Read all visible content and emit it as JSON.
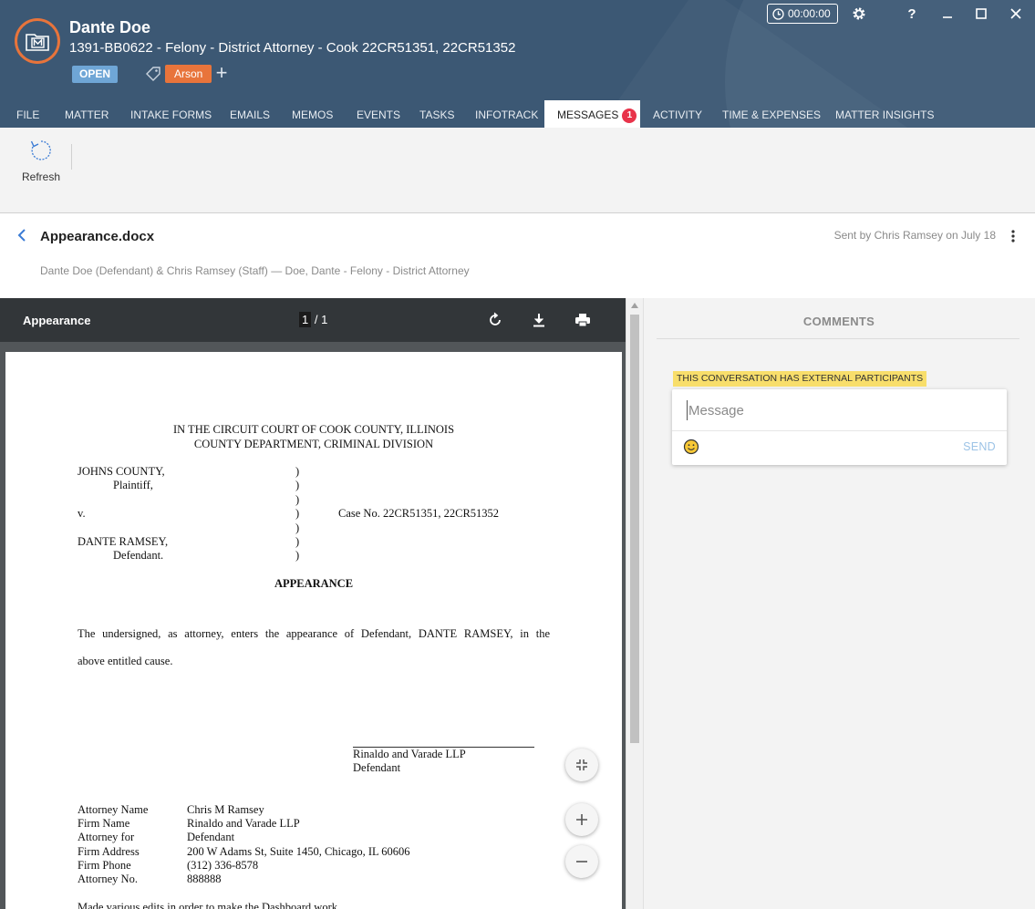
{
  "header": {
    "client_name": "Dante Doe",
    "matter": "1391-BB0622 - Felony - District Attorney - Cook 22CR51351, 22CR51352",
    "status": "OPEN",
    "tag": "Arson",
    "add_tag": "+",
    "timer": "00:00:00",
    "status_color": "#6fa6d6",
    "tag_color": "#e8743b",
    "brand_color": "#3c5874"
  },
  "window_controls": {
    "help": "?",
    "icons": [
      "gear-icon",
      "question-icon",
      "minimize-icon",
      "maximize-icon",
      "close-icon"
    ]
  },
  "tabs": [
    {
      "label": "FILE"
    },
    {
      "label": "MATTER"
    },
    {
      "label": "INTAKE FORMS"
    },
    {
      "label": "EMAILS"
    },
    {
      "label": "MEMOS"
    },
    {
      "label": "EVENTS"
    },
    {
      "label": "TASKS"
    },
    {
      "label": "INFOTRACK"
    },
    {
      "label": "MESSAGES",
      "count": "1",
      "active": true
    },
    {
      "label": "ACTIVITY"
    },
    {
      "label": "TIME & EXPENSES"
    },
    {
      "label": "MATTER INSIGHTS"
    }
  ],
  "toolbar": {
    "refresh_label": "Refresh"
  },
  "message": {
    "title": "Appearance.docx",
    "sent_by": "Sent by Chris Ramsey on July 18",
    "participants": "Dante Doe (Defendant) & Chris Ramsey (Staff) — Doe, Dante - Felony - District Attorney"
  },
  "viewer": {
    "doc_name": "Appearance",
    "page_current": "1",
    "page_total": "/ 1",
    "icons": [
      "rotate-icon",
      "download-icon",
      "print-icon",
      "fit-page-icon",
      "zoom-in-icon",
      "zoom-out-icon"
    ]
  },
  "document": {
    "court_line1": "IN THE CIRCUIT COURT OF COOK COUNTY, ILLINOIS",
    "court_line2": "COUNTY DEPARTMENT, CRIMINAL DIVISION",
    "plaintiff_name": "JOHNS COUNTY,",
    "plaintiff_role": "Plaintiff,",
    "versus": "v.",
    "case_no": "Case No. 22CR51351, 22CR51352",
    "defendant_name": "DANTE RAMSEY,",
    "defendant_role": "Defendant.",
    "paren": ")",
    "heading": "APPEARANCE",
    "body_line1": "The undersigned, as attorney, enters the appearance of Defendant, DANTE RAMSEY, in the",
    "body_line2": "above entitled cause.",
    "sig_firm": "Rinaldo and Varade LLP",
    "sig_role": "Defendant",
    "info": [
      {
        "label": "Attorney Name",
        "value": "Chris M Ramsey"
      },
      {
        "label": "Firm Name",
        "value": "Rinaldo and Varade LLP"
      },
      {
        "label": "Attorney for",
        "value": "Defendant"
      },
      {
        "label": "Firm Address",
        "value": "200 W Adams St, Suite 1450, Chicago, IL 60606"
      },
      {
        "label": "Firm Phone",
        "value": "(312) 336-8578"
      },
      {
        "label": "Attorney No.",
        "value": "888888"
      }
    ],
    "cutoff_line": "Made various edits in order to make the Dashboard work"
  },
  "comments": {
    "title": "COMMENTS",
    "external_banner": "THIS CONVERSATION HAS EXTERNAL PARTICIPANTS",
    "message_placeholder": "Message",
    "message_value": "",
    "send_label": "SEND",
    "banner_color": "#f8de6b"
  }
}
